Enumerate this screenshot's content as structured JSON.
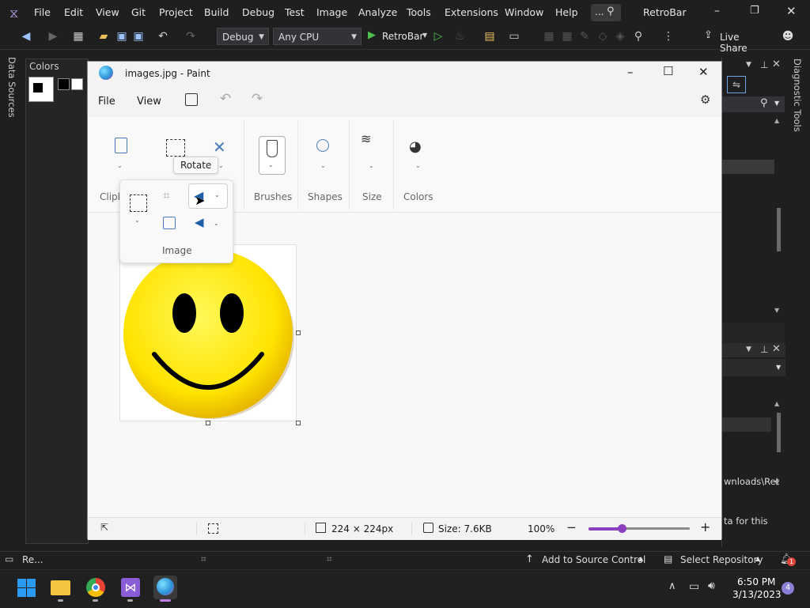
{
  "vs": {
    "menu": [
      "File",
      "Edit",
      "View",
      "Git",
      "Project",
      "Build",
      "Debug",
      "Test",
      "Image",
      "Analyze",
      "Tools",
      "Extensions",
      "Window",
      "Help"
    ],
    "search_label": "...",
    "solution_name": "RetroBar",
    "toolbar": {
      "config": "Debug",
      "platform": "Any CPU",
      "run_label": "RetroBar",
      "live_share": "Live Share"
    },
    "left_strip_label": "Data Sources",
    "colors_panel_title": "Colors",
    "right_strip_label": "Diagnostic Tools",
    "right_snippets": {
      "path": "wnloads\\Ret",
      "hint": "ta for this"
    },
    "status": {
      "ready": "Re...",
      "add_source": "Add to Source Control",
      "select_repo": "Select Repository",
      "notif_count": "1"
    }
  },
  "paint": {
    "title": "images.jpg - Paint",
    "menu": {
      "file": "File",
      "view": "View"
    },
    "ribbon": {
      "clipboard": "Clipb",
      "brushes": "Brushes",
      "shapes": "Shapes",
      "size": "Size",
      "colors": "Colors",
      "image": "Image"
    },
    "tooltip": "Rotate",
    "status": {
      "dimensions": "224 × 224px",
      "size": "Size: 7.6KB",
      "zoom": "100%",
      "zoom_level": 0.33
    }
  },
  "taskbar": {
    "time": "6:50 PM",
    "date": "3/13/2023",
    "badge": "4"
  },
  "colors": {
    "accent": "#8a3fbf",
    "vs_bg": "#1f1f1f",
    "paint_bg": "#f8f8f8",
    "smiley": "#ffe400"
  }
}
